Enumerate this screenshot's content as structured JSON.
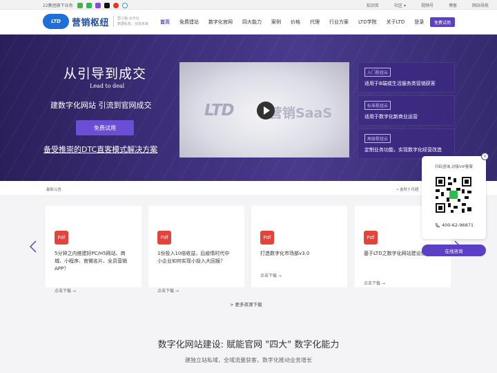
{
  "topbar": {
    "left_text": "22集团旗下业务",
    "links": [
      "知识库",
      "社区",
      "视频号",
      "博客",
      "网站导航"
    ]
  },
  "header": {
    "logo_badge": "LTD",
    "logo_name": "营销枢纽",
    "logo_sub_line1": "营三版·云平台",
    "logo_sub_line2": "数据私有，创造未来",
    "nav": [
      "首页",
      "免费建站",
      "数字化官网",
      "四大能力",
      "案例",
      "价格",
      "代理",
      "行业方案",
      "LTD学院",
      "关于LTD",
      "登录"
    ],
    "trial_label": "免费试用"
  },
  "hero": {
    "title": "从引导到成交",
    "title_en": "Lead to deal",
    "subtitle": "建数字化网站 引流到官网成交",
    "button": "免费试用",
    "link": "备受推崇的DTC直客模式解决方案",
    "video_text_1": "LTD",
    "video_text_2": "营销SaaS",
    "plans": [
      {
        "tag": "入门枢纽云",
        "desc": "适用于B端或生活服务类营销获客"
      },
      {
        "tag": "标准枢纽云",
        "desc": "适用于数字化新商业运营"
      },
      {
        "tag": "高级枢纽云",
        "desc": "定制业务功能，实现数字化经营改造"
      }
    ]
  },
  "notice": {
    "label": "最新公告",
    "text": "• 金秋十月超"
  },
  "resources": {
    "cards": [
      {
        "icon": "Pdf",
        "title": "5分钟之内搭建好PC/H5网站、商城、小程序、官微名片、全员营销APP？",
        "download": "点击下载 →"
      },
      {
        "icon": "Pdf",
        "title": "1份投入10倍收益，后疫情时代中小企业如何实现小投入大回报？",
        "download": "点击下载 →"
      },
      {
        "icon": "Pdf",
        "title": "打造数字化市场部v3.0",
        "download": "点击下载 →"
      },
      {
        "icon": "Pdf",
        "title": "基于LTD之数字化网站建设指南",
        "download": "点击下载 →"
      }
    ],
    "more": "> 更多资源下载"
  },
  "section": {
    "title": "数字化网站建设: 赋能官网 \"四大\" 数字化能力",
    "subtitle": "建独立站私域，全域流量获客，数字化推动业务增长"
  },
  "float": {
    "close": "×",
    "text": "扫码咨询,对接VIP客服",
    "phone": "400-62-96871",
    "button": "在线咨询"
  },
  "colors": {
    "brand": "#5b3fc4",
    "hero_bg": "#3d2f7a",
    "pdf_red": "#e2433a"
  }
}
